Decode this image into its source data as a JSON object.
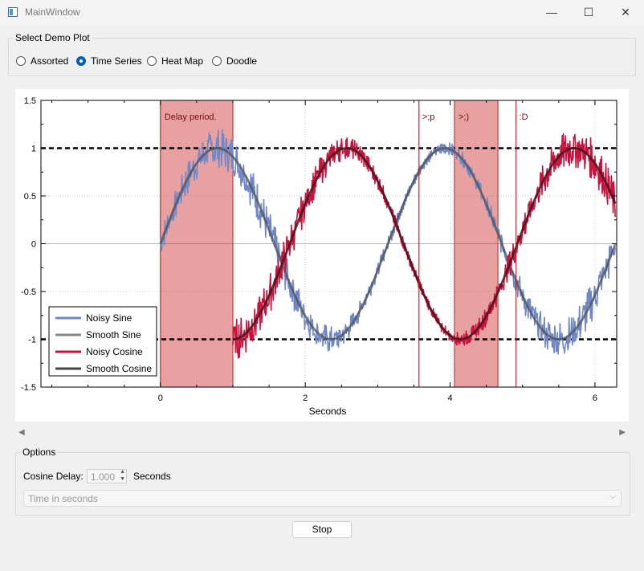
{
  "window": {
    "title": "MainWindow",
    "minimize": "—",
    "maximize": "☐",
    "close": "✕"
  },
  "select_group": {
    "title": "Select Demo Plot",
    "options": [
      {
        "label": "Assorted",
        "checked": false
      },
      {
        "label": "Time Series",
        "checked": true
      },
      {
        "label": "Heat Map",
        "checked": false
      },
      {
        "label": "Doodle",
        "checked": false
      }
    ]
  },
  "chart_data": {
    "type": "line",
    "xlabel": "Seconds",
    "ylabel": "",
    "xlim": [
      -1.65,
      6.3
    ],
    "ylim": [
      -1.5,
      1.5
    ],
    "x_ticks": [
      "0",
      "2",
      "4",
      "6"
    ],
    "y_ticks": [
      "1.5",
      "1",
      "0.5",
      "0",
      "-0.5",
      "-1",
      "-1.5"
    ],
    "grid": true,
    "legend_position": "bottom-left",
    "series": [
      {
        "name": "Noisy Sine",
        "color": "#7088c8",
        "function": "sin(2*x)",
        "noise": true,
        "x_start": 0,
        "x_end": 6.28
      },
      {
        "name": "Smooth Sine",
        "color": "#888888",
        "function": "sin(2*x)",
        "noise": false,
        "x_start": 0,
        "x_end": 6.28
      },
      {
        "name": "Noisy Cosine",
        "color": "#c8143c",
        "function": "-cos(2*(x-1))",
        "noise": true,
        "x_start": 1,
        "x_end": 6.28
      },
      {
        "name": "Smooth Cosine",
        "color": "#444444",
        "function": "-cos(2*(x-1))",
        "noise": false,
        "x_start": 1,
        "x_end": 6.28
      }
    ],
    "reference_lines_y": [
      1,
      -1
    ],
    "shaded_regions": [
      {
        "x0": 0,
        "x1": 1.0,
        "label": "Delay period."
      },
      {
        "x0": 4.06,
        "x1": 4.66,
        "label": ">;)"
      }
    ],
    "vertical_markers": [
      {
        "x": 3.57,
        "label": ">;p"
      },
      {
        "x": 4.91,
        "label": ":D"
      }
    ]
  },
  "options_group": {
    "title": "Options",
    "delay_label": "Cosine Delay:",
    "delay_value": "1.000",
    "delay_unit": "Seconds",
    "combo_placeholder": "Time in seconds"
  },
  "stop_button": "Stop"
}
